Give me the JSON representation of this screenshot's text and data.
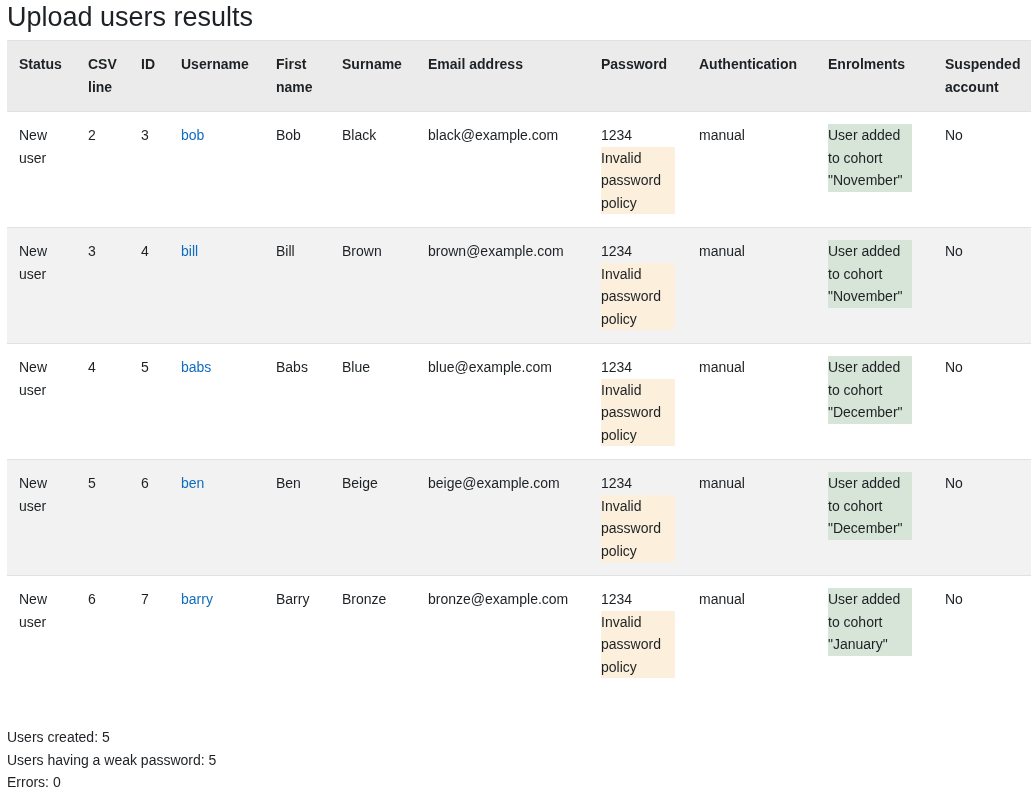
{
  "title": "Upload users results",
  "table": {
    "columns": [
      "Status",
      "CSV line",
      "ID",
      "Username",
      "First name",
      "Surname",
      "Email address",
      "Password",
      "Authentication",
      "Enrolments",
      "Suspended account"
    ],
    "rows": [
      {
        "status": "New user",
        "csv_line": "2",
        "id": "3",
        "username": "bob",
        "first_name": "Bob",
        "surname": "Black",
        "email": "black@example.com",
        "password": "1234",
        "password_warning": "Invalid password policy",
        "authentication": "manual",
        "enrolment": "User added to cohort \"November\"",
        "suspended": "No"
      },
      {
        "status": "New user",
        "csv_line": "3",
        "id": "4",
        "username": "bill",
        "first_name": "Bill",
        "surname": "Brown",
        "email": "brown@example.com",
        "password": "1234",
        "password_warning": "Invalid password policy",
        "authentication": "manual",
        "enrolment": "User added to cohort \"November\"",
        "suspended": "No"
      },
      {
        "status": "New user",
        "csv_line": "4",
        "id": "5",
        "username": "babs",
        "first_name": "Babs",
        "surname": "Blue",
        "email": "blue@example.com",
        "password": "1234",
        "password_warning": "Invalid password policy",
        "authentication": "manual",
        "enrolment": "User added to cohort \"December\"",
        "suspended": "No"
      },
      {
        "status": "New user",
        "csv_line": "5",
        "id": "6",
        "username": "ben",
        "first_name": "Ben",
        "surname": "Beige",
        "email": "beige@example.com",
        "password": "1234",
        "password_warning": "Invalid password policy",
        "authentication": "manual",
        "enrolment": "User added to cohort \"December\"",
        "suspended": "No"
      },
      {
        "status": "New user",
        "csv_line": "6",
        "id": "7",
        "username": "barry",
        "first_name": "Barry",
        "surname": "Bronze",
        "email": "bronze@example.com",
        "password": "1234",
        "password_warning": "Invalid password policy",
        "authentication": "manual",
        "enrolment": "User added to cohort \"January\"",
        "suspended": "No"
      }
    ]
  },
  "summary": [
    "Users created: 5",
    "Users having a weak password: 5",
    "Errors: 0"
  ]
}
